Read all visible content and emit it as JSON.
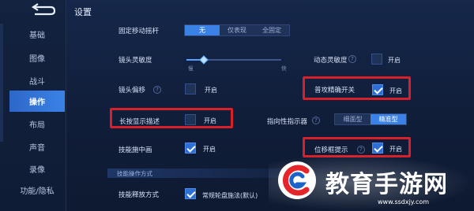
{
  "header": {
    "title": "设置"
  },
  "sidebar": {
    "items": [
      {
        "label": "基础"
      },
      {
        "label": "图像"
      },
      {
        "label": "战斗"
      },
      {
        "label": "操作",
        "active": true
      },
      {
        "label": "布局"
      },
      {
        "label": "声音"
      },
      {
        "label": "录像"
      },
      {
        "label": "功能/隐私"
      }
    ]
  },
  "settings": {
    "fixed_joystick": {
      "label": "固定移动摇杆",
      "options": [
        "无",
        "仅表现",
        "全固定"
      ],
      "selected": "无"
    },
    "camera_sensitivity": {
      "label": "镜头灵敏度",
      "low": "慢",
      "high": "快",
      "value": 0.18
    },
    "dynamic_sensitivity": {
      "label": "动态灵敏度",
      "toggle_label": "开启",
      "checked": false
    },
    "camera_offset": {
      "label": "镜头偏移",
      "toggle_label": "开启",
      "checked": false
    },
    "precise_aim": {
      "label": "普攻精确开关",
      "toggle_label": "开启",
      "checked": true
    },
    "long_press_desc": {
      "label": "长按显示描述",
      "toggle_label": "开启",
      "checked": false
    },
    "target_indicator": {
      "label": "指向性指示器",
      "options": [
        "细面型",
        "精准型"
      ],
      "selected": "精准型"
    },
    "skill_center": {
      "label": "技能施中画",
      "toggle_label": "开启",
      "checked": true
    },
    "move_cancel_hint": {
      "label": "位移框提示",
      "toggle_label": "开启",
      "checked": true
    },
    "section_title": "技能操作方式",
    "skill_release": {
      "label": "技能释放方式",
      "option_label": "常规轮盘施法(默认)",
      "checked": true
    }
  },
  "watermark": {
    "title": "教育手游网",
    "url": "www.ssdxjy.com"
  },
  "colors": {
    "accent": "#3a82e6",
    "highlight_box": "#d8202a",
    "background": "#101d36"
  }
}
